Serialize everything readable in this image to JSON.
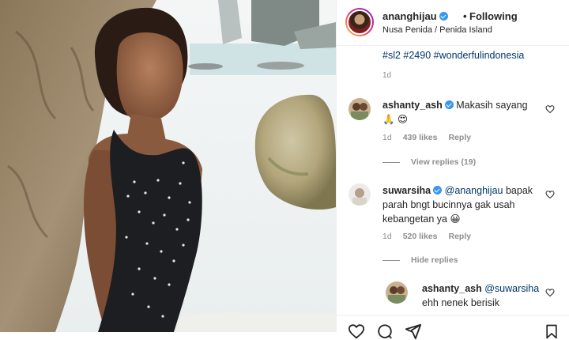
{
  "header": {
    "username": "ananghijau",
    "separator": "•",
    "follow_state": "Following",
    "location": "Nusa Penida / Penida Island"
  },
  "caption": {
    "hashtags": "#sl2 #2490 #wonderfulindonesia",
    "time": "1d"
  },
  "comments": [
    {
      "username": "ashanty_ash",
      "text": "Makasih sayang",
      "emojis": "🙏 😍",
      "time": "1d",
      "likes": "439 likes",
      "reply_label": "Reply",
      "view_replies": "View replies (19)"
    },
    {
      "username": "suwarsiha",
      "mention": "@ananghijau",
      "text_line1": "bapak",
      "text_line2": "parah bngt bucinnya gak usah",
      "text_line3": "kebangetan ya 😀",
      "time": "1d",
      "likes": "520 likes",
      "reply_label": "Reply",
      "hide_replies": "Hide replies"
    }
  ],
  "reply": {
    "username": "ashanty_ash",
    "mention": "@suwarsiha",
    "text": "ehh nenek berisik"
  },
  "colors": {
    "link": "#00376b",
    "muted": "#8e8e8e",
    "verified": "#3897f0"
  },
  "icons": [
    "verified-badge-icon",
    "heart-icon",
    "comment-icon",
    "share-icon",
    "bookmark-icon"
  ]
}
